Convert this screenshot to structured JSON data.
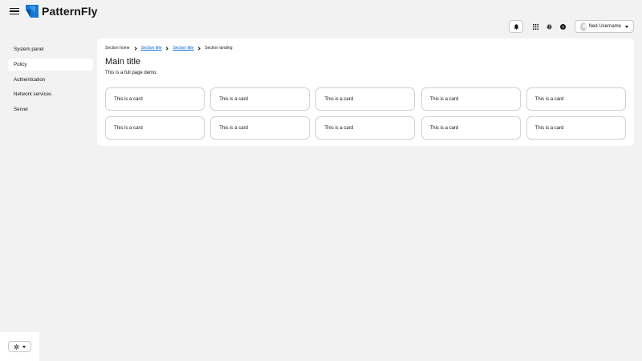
{
  "header": {
    "brand": "PatternFly",
    "menu_icon": "hamburger-icon",
    "logo_icon": "patternfly-logo",
    "toolbar": [
      {
        "icon": "bell-icon"
      },
      {
        "icon": "grid-icon"
      },
      {
        "icon": "gear-icon"
      },
      {
        "icon": "question-circle-icon"
      }
    ],
    "user": {
      "name": "Ned Username",
      "icon": "caret-down-icon"
    }
  },
  "sidebar": {
    "items": [
      {
        "label": "System panel",
        "active": false
      },
      {
        "label": "Policy",
        "active": true
      },
      {
        "label": "Authentication",
        "active": false
      },
      {
        "label": "Network services",
        "active": false
      },
      {
        "label": "Server",
        "active": false
      }
    ]
  },
  "breadcrumb": [
    {
      "label": "Section home",
      "link": false
    },
    {
      "label": "Section title",
      "link": true
    },
    {
      "label": "Section title",
      "link": true
    },
    {
      "label": "Section landing",
      "link": false
    }
  ],
  "main": {
    "title": "Main title",
    "subtitle": "This is a full page demo.",
    "cards": [
      "This is a card",
      "This is a card",
      "This is a card",
      "This is a card",
      "This is a card",
      "This is a card",
      "This is a card",
      "This is a card",
      "This is a card",
      "This is a card"
    ]
  },
  "theme": {
    "icon": "sun-icon"
  },
  "colors": {
    "link": "#0066cc",
    "background": "#f2f2f2",
    "surface": "#ffffff",
    "logo_blue": "#1578d4"
  }
}
